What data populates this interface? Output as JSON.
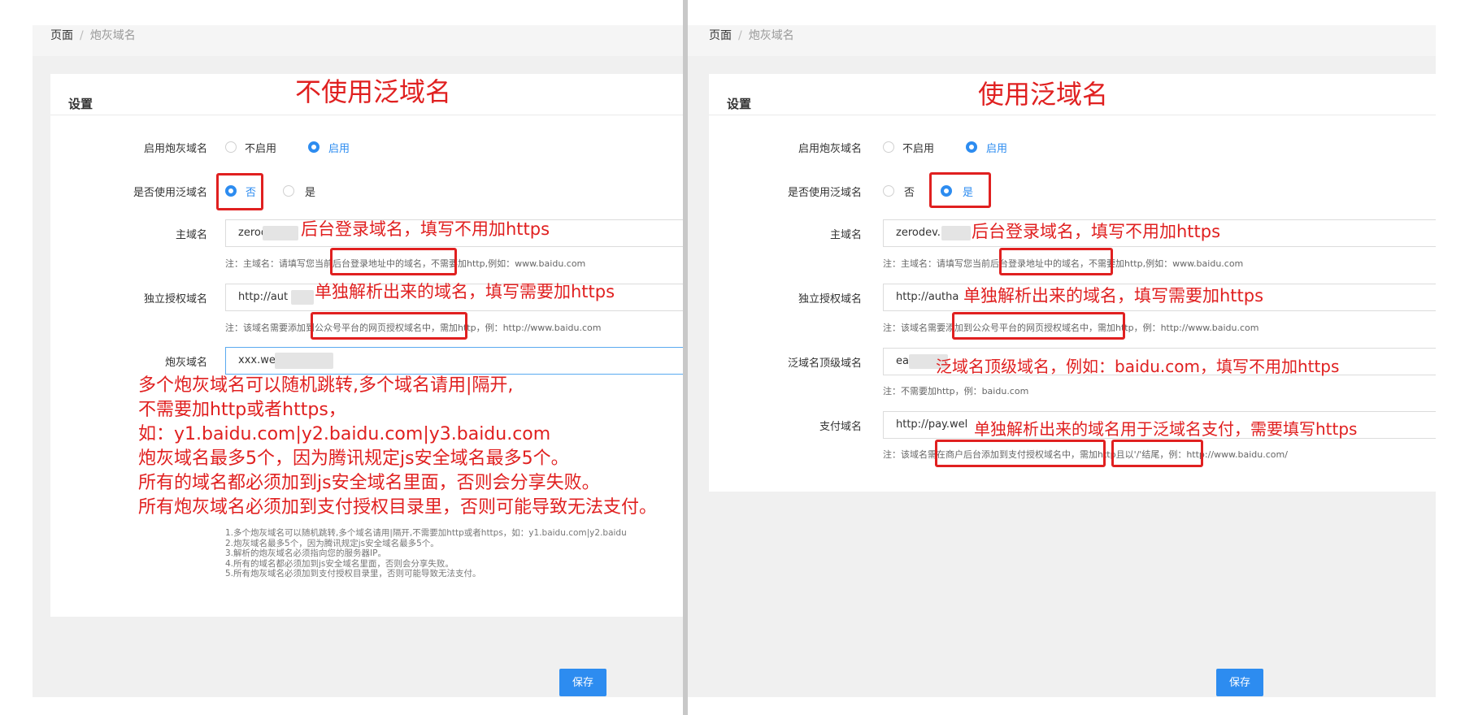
{
  "left": {
    "breadcrumb": {
      "page": "页面",
      "current": "炮灰域名"
    },
    "card_title": "设置",
    "heading": "不使用泛域名",
    "enable": {
      "label": "启用炮灰域名",
      "off": "不启用",
      "on": "启用",
      "selected": "on"
    },
    "wildcard": {
      "label": "是否使用泛域名",
      "no": "否",
      "yes": "是",
      "selected": "no"
    },
    "main_domain": {
      "label": "主域名",
      "value": "zerod",
      "annotation": "后台登录域名，填写不用加https",
      "note": "注：主域名：请填写您当前后台登录地址中的域名，不需要加http,例如：www.baidu.com"
    },
    "auth_domain": {
      "label": "独立授权域名",
      "value": "http://aut",
      "annotation": "单独解析出来的域名，填写需要加https",
      "note": "注：该域名需要添加到公众号平台的网页授权域名中，需加http，例：http://www.baidu.com"
    },
    "cannon_domain": {
      "label": "炮灰域名",
      "value": "xxx.wel",
      "annotation_lines": [
        "多个炮灰域名可以随机跳转,多个域名请用|隔开,",
        "不需要加http或者https，",
        "如：y1.baidu.com|y2.baidu.com|y3.baidu.com",
        "炮灰域名最多5个，因为腾讯规定js安全域名最多5个。",
        "所有的域名都必须加到js安全域名里面，否则会分享失败。",
        "所有炮灰域名必须加到支付授权目录里，否则可能导致无法支付。"
      ],
      "tips": [
        "1.多个炮灰域名可以随机跳转,多个域名请用|隔开,不需要加http或者https，如：y1.baidu.com|y2.baidu",
        "2.炮灰域名最多5个，因为腾讯规定js安全域名最多5个。",
        "3.解析的炮灰域名必须指向您的服务器IP。",
        "4.所有的域名都必须加到js安全域名里面，否则会分享失败。",
        "5.所有炮灰域名必须加到支付授权目录里，否则可能导致无法支付。"
      ]
    },
    "save_label": "保存"
  },
  "right": {
    "breadcrumb": {
      "page": "页面",
      "current": "炮灰域名"
    },
    "card_title": "设置",
    "heading": "使用泛域名",
    "enable": {
      "label": "启用炮灰域名",
      "off": "不启用",
      "on": "启用",
      "selected": "on"
    },
    "wildcard": {
      "label": "是否使用泛域名",
      "no": "否",
      "yes": "是",
      "selected": "yes"
    },
    "main_domain": {
      "label": "主域名",
      "value": "zerodev.",
      "annotation": "后台登录域名，填写不用加https",
      "note": "注：主域名：请填写您当前后台登录地址中的域名，不需要加http,例如：www.baidu.com"
    },
    "auth_domain": {
      "label": "独立授权域名",
      "value": "http://autha",
      "annotation": "单独解析出来的域名，填写需要加https",
      "note": "注：该域名需要添加到公众号平台的网页授权域名中，需加http，例：http://www.baidu.com"
    },
    "top_domain": {
      "label": "泛域名顶级域名",
      "value": "ea",
      "annotation": "泛域名顶级域名，例如：baidu.com，填写不用加https",
      "note": "注：不需要加http，例：baidu.com"
    },
    "pay_domain": {
      "label": "支付域名",
      "value": "http://pay.wel",
      "annotation": "单独解析出来的域名用于泛域名支付，需要填写https",
      "note": "注：该域名需在商户后台添加到支付授权域名中，需加http且以'/'结尾，例：http://www.baidu.com/"
    },
    "save_label": "保存"
  },
  "colors": {
    "accent": "#2d8cf0",
    "annotation_red": "#e02020"
  }
}
